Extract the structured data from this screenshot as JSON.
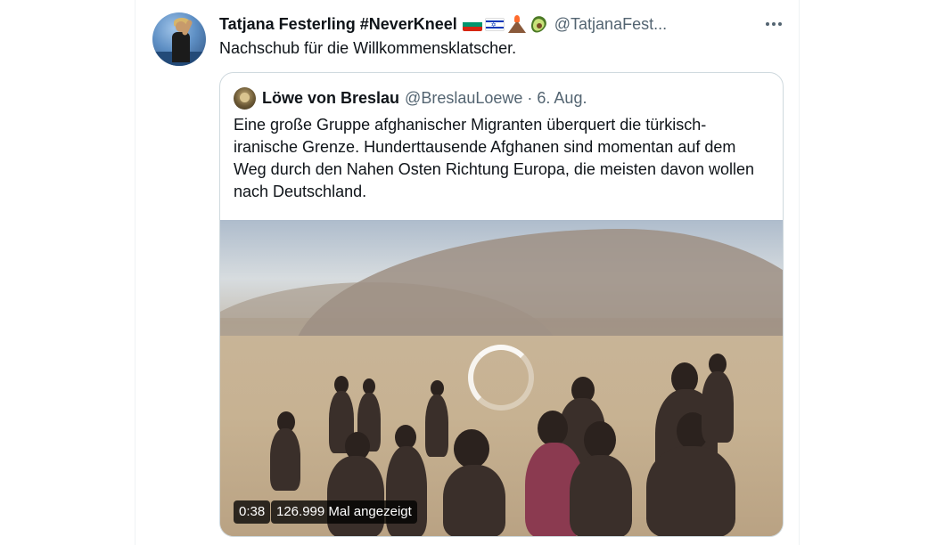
{
  "tweet": {
    "author_name": "Tatjana Festerling #NeverKneel",
    "author_emoji": [
      "bulgaria-flag",
      "israel-flag",
      "volcano",
      "avocado"
    ],
    "author_handle": "@TatjanaFest...",
    "text": "Nachschub für die Willkommensklatscher."
  },
  "quoted_tweet": {
    "author_name": "Löwe von Breslau",
    "author_handle": "@BreslauLoewe",
    "separator": "·",
    "date": "6. Aug.",
    "text": "Eine große Gruppe afghanischer Migranten überquert die türkisch-iranische Grenze. Hunderttausende Afghanen sind momentan auf dem Weg durch den Nahen Osten Richtung Europa, die meisten davon wollen nach Deutschland.",
    "video": {
      "duration": "0:38",
      "views": "126.999 Mal angezeigt",
      "state": "loading"
    }
  }
}
